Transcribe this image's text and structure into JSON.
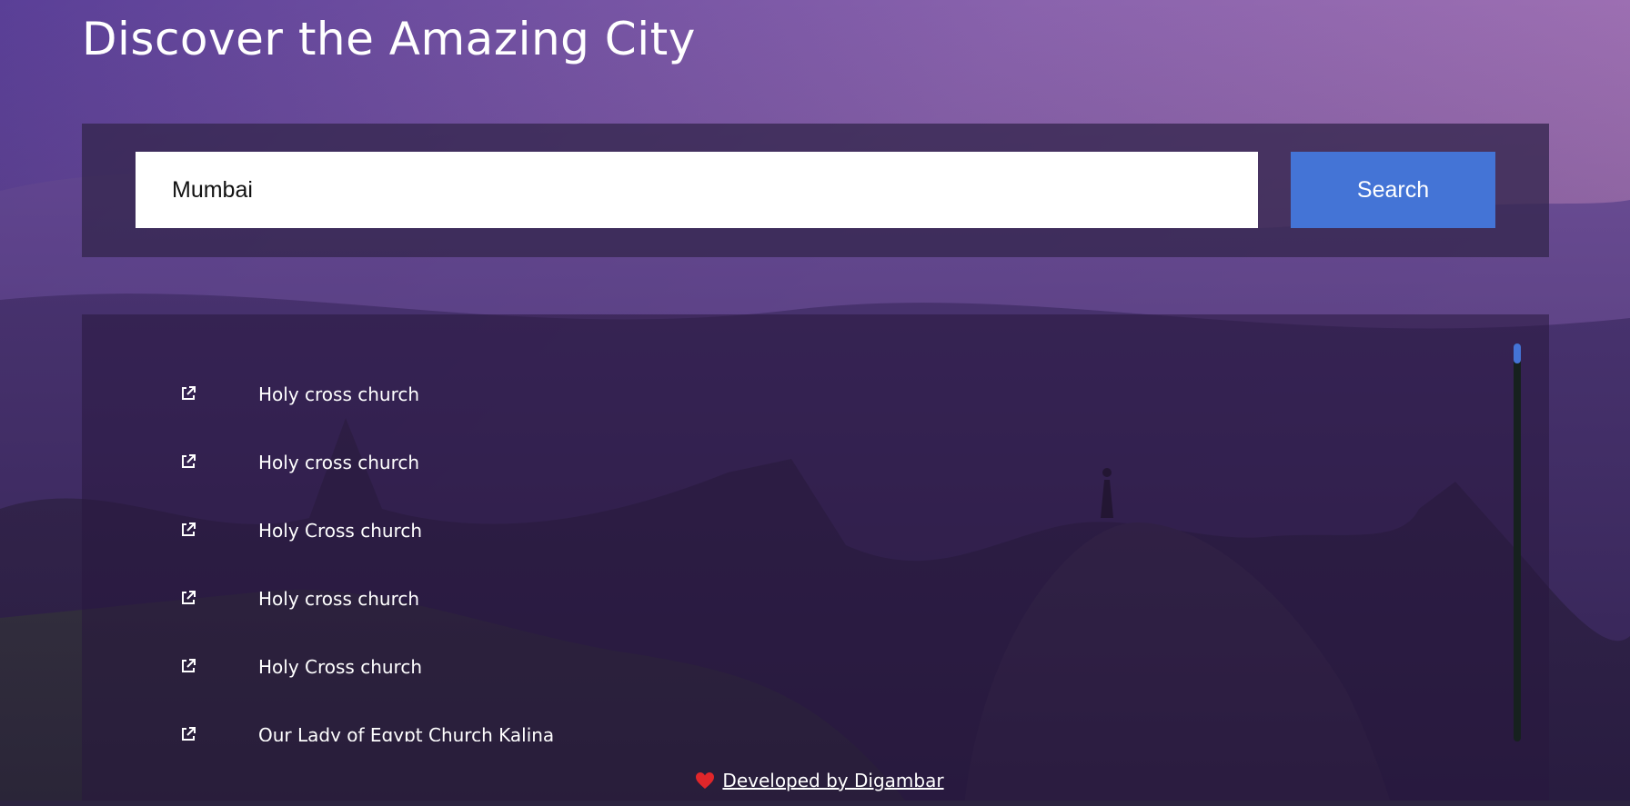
{
  "page": {
    "title": "Discover the Amazing City"
  },
  "search": {
    "value": "Mumbai",
    "button_label": "Search"
  },
  "results": {
    "items": [
      {
        "label": "Holy cross church",
        "icon": "external-link-icon"
      },
      {
        "label": "Holy cross church",
        "icon": "external-link-icon"
      },
      {
        "label": "Holy Cross church",
        "icon": "external-link-icon"
      },
      {
        "label": "Holy cross church",
        "icon": "external-link-icon"
      },
      {
        "label": "Holy Cross church",
        "icon": "external-link-icon"
      },
      {
        "label": "Our Lady of Egypt Church Kalina",
        "icon": "external-link-icon"
      }
    ],
    "scroll_position": 0
  },
  "footer": {
    "icon": "heart-icon",
    "link_text": "Developed by Digambar"
  },
  "colors": {
    "accent": "#4474d6",
    "heart": "#e0262a",
    "text": "#ffffff"
  }
}
